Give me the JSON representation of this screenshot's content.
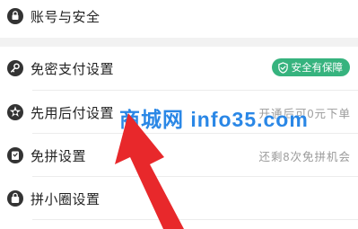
{
  "settings": {
    "account_security": {
      "label": "账号与安全",
      "icon": "account-lock-icon"
    },
    "password_free_pay": {
      "label": "免密支付设置",
      "icon": "key-icon",
      "badge": "安全有保障",
      "badge_icon": "shield-check-icon"
    },
    "pay_later": {
      "label": "先用后付设置",
      "icon": "pay-later-icon",
      "hint": "开通后可0元下单"
    },
    "group_free": {
      "label": "免拼设置",
      "icon": "free-group-icon",
      "hint": "还剩8次免拼机会"
    },
    "pin_circle": {
      "label": "拼小圈设置",
      "icon": "bag-icon"
    }
  },
  "watermark": {
    "text": "商城网 info35.com"
  },
  "colors": {
    "badge_green": "#36b37e",
    "arrow_red": "#e8282b",
    "watermark_blue": "#2a87e6",
    "text": "#222222",
    "hint": "#9a9a9a"
  }
}
